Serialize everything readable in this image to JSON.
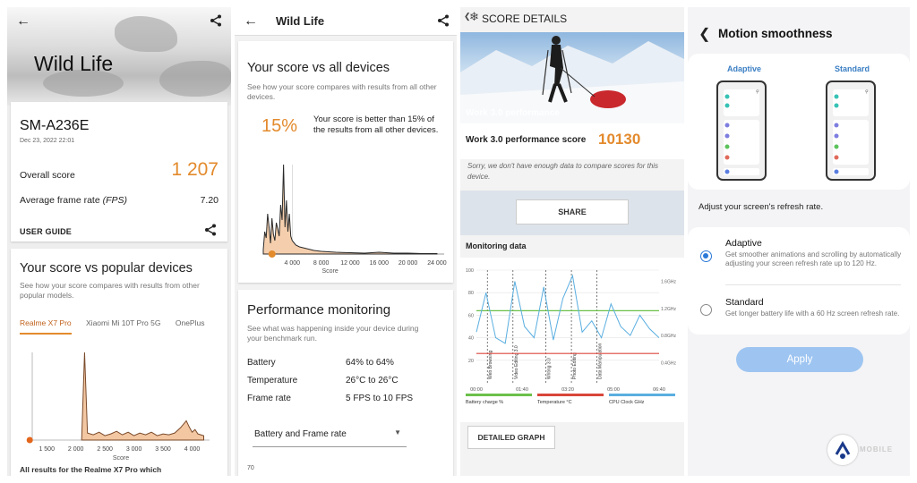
{
  "panel1": {
    "title": "Wild Life",
    "back_icon": "back-arrow-icon",
    "share_icon": "share-icon",
    "device": {
      "name": "SM-A236E",
      "date": "Dec 23, 2022 22:01",
      "overall_label": "Overall score",
      "overall_value": "1 207",
      "fps_label": "Average frame rate",
      "fps_unit": "(FPS)",
      "fps_value": "7.20",
      "user_guide": "USER GUIDE"
    },
    "popular": {
      "title": "Your score vs popular devices",
      "subtitle": "See how your score compares with results from other popular models.",
      "tabs": [
        "Realme X7 Pro",
        "Xiaomi Mi 10T Pro 5G",
        "OnePlus"
      ],
      "active_tab": 0,
      "x_ticks": [
        "1 500",
        "2 000",
        "2 500",
        "3 000",
        "3 500",
        "4 000"
      ],
      "x_label": "Score",
      "footer": "All results for the Realme X7 Pro which"
    }
  },
  "panel2": {
    "title": "Wild Life",
    "vs_all": {
      "title": "Your score vs all devices",
      "subtitle": "See how your score compares with results from all other devices.",
      "percent": "15%",
      "text": "Your score is better than 15% of the results from all other devices.",
      "x_ticks": [
        "4 000",
        "8 000",
        "12 000",
        "16 000",
        "20 000",
        "24 000"
      ],
      "x_label": "Score"
    },
    "perf": {
      "title": "Performance monitoring",
      "subtitle": "See what was happening inside your device during your benchmark run.",
      "rows": [
        {
          "label": "Battery",
          "value": "64% to 64%"
        },
        {
          "label": "Temperature",
          "value": "26°C to 26°C"
        },
        {
          "label": "Frame rate",
          "value": "5 FPS to 10 FPS"
        }
      ],
      "dropdown": "Battery and Frame rate",
      "partial_tick": "70"
    }
  },
  "panel3": {
    "title": "SCORE DETAILS",
    "hero_label": "Work 3.0 performance",
    "score_label": "Work 3.0 performance score",
    "score_value": "10130",
    "sorry": "Sorry, we don't have enough data to compare scores for this device.",
    "share": "SHARE",
    "monitoring_label": "Monitoring data",
    "y_left": [
      "100",
      "80",
      "60",
      "40",
      "20"
    ],
    "y_right": [
      "1.6GHz",
      "1.2GHz",
      "0.8GHz",
      "0.4GHz"
    ],
    "x_ticks": [
      "00:00",
      "01:40",
      "03:20",
      "05:00",
      "06:40"
    ],
    "markers": [
      "Web Browsing",
      "Video Editing 3.0",
      "Writing 3.0",
      "Photo Editing",
      "Data Manipulation"
    ],
    "legend": [
      {
        "label": "Battery charge %",
        "color": "#6cc04a"
      },
      {
        "label": "Temperature °C",
        "color": "#d9463b"
      },
      {
        "label": "CPU Clock GHz",
        "color": "#5aaee0"
      }
    ],
    "detailed": "DETAILED GRAPH"
  },
  "panel4": {
    "title": "Motion smoothness",
    "preview_labels": [
      "Adaptive",
      "Standard"
    ],
    "adjust": "Adjust your screen's refresh rate.",
    "options": [
      {
        "title": "Adaptive",
        "desc": "Get smoother animations and scrolling by automatically adjusting your screen refresh rate up to 120 Hz.",
        "selected": true
      },
      {
        "title": "Standard",
        "desc": "Get longer battery life with a 60 Hz screen refresh rate.",
        "selected": false
      }
    ],
    "apply": "Apply",
    "watermark": "MOBILE"
  },
  "chart_data": [
    {
      "type": "area",
      "title": "",
      "xlabel": "Score",
      "x_ticks": [
        "1 500",
        "2 000",
        "2 500",
        "3 000",
        "3 500",
        "4 000"
      ],
      "x": [
        1200,
        2100,
        2150,
        2200,
        2300,
        2400,
        2500,
        2600,
        2700,
        2800,
        2900,
        3000,
        3100,
        3200,
        3300,
        3400,
        3500,
        3600,
        3700,
        3800,
        3900,
        3950,
        4000,
        4050,
        4100,
        4200
      ],
      "values": [
        0,
        0,
        100,
        8,
        6,
        9,
        5,
        7,
        10,
        6,
        9,
        5,
        8,
        6,
        9,
        5,
        7,
        6,
        8,
        14,
        22,
        15,
        9,
        12,
        7,
        5
      ],
      "marker_score": 1207
    },
    {
      "type": "area",
      "title": "",
      "xlabel": "Score",
      "x_ticks": [
        "4 000",
        "8 000",
        "12 000",
        "16 000",
        "20 000",
        "24 000"
      ],
      "x": [
        0,
        200,
        400,
        600,
        800,
        1000,
        1200,
        1400,
        1600,
        1800,
        2000,
        2200,
        2400,
        2600,
        2800,
        3000,
        3200,
        3400,
        3600,
        3800,
        4000,
        4500,
        5000,
        6000,
        7000,
        8000,
        10000,
        12000,
        14000,
        16000,
        18000,
        20000,
        22000,
        24000
      ],
      "values": [
        5,
        25,
        18,
        45,
        30,
        12,
        40,
        22,
        15,
        35,
        28,
        20,
        55,
        38,
        100,
        30,
        60,
        25,
        45,
        20,
        15,
        10,
        8,
        6,
        4,
        3,
        2,
        1.5,
        1,
        2,
        1,
        1,
        0.5,
        0.5
      ],
      "marker_score": 1207,
      "percentile": 15
    },
    {
      "type": "line",
      "title": "",
      "ylim": [
        0,
        100
      ],
      "x_ticks": [
        "00:00",
        "01:40",
        "03:20",
        "05:00",
        "06:40"
      ],
      "series": [
        {
          "name": "Battery charge %",
          "values": [
            64,
            64,
            64,
            64,
            64,
            64,
            64,
            64,
            64,
            64,
            64,
            64,
            64,
            64,
            64,
            64,
            64,
            64,
            64,
            64
          ]
        },
        {
          "name": "Temperature °C",
          "values": [
            26,
            26,
            26,
            26,
            26,
            26,
            26,
            26,
            26,
            26,
            26,
            26,
            26,
            26,
            26,
            26,
            26,
            26,
            26,
            26
          ]
        },
        {
          "name": "CPU Clock GHz",
          "values": [
            45,
            80,
            40,
            35,
            90,
            50,
            40,
            85,
            38,
            75,
            95,
            45,
            55,
            40,
            70,
            50,
            42,
            60,
            48,
            40
          ]
        }
      ]
    }
  ]
}
